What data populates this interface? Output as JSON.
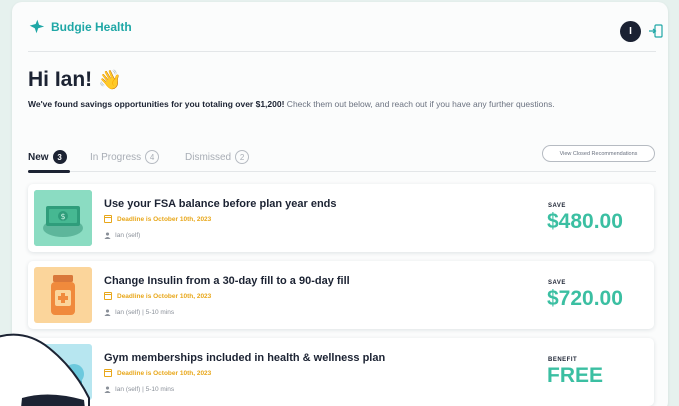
{
  "header": {
    "brand": "Budgie Health",
    "avatar_initial": "I",
    "brand_color": "#1fa7a6"
  },
  "greeting": {
    "title": "Hi Ian!",
    "emoji": "👋",
    "subtitle_bold": "We've found savings opportunities for you totaling over $1,200!",
    "subtitle_rest": " Check them out below, and reach out if you have any further questions."
  },
  "tabs": [
    {
      "label": "New",
      "count": "3"
    },
    {
      "label": "In Progress",
      "count": "4"
    },
    {
      "label": "Dismissed",
      "count": "2"
    }
  ],
  "closed_button": "View Closed Recommendations",
  "cards": [
    {
      "title": "Use your FSA balance before plan year ends",
      "deadline": "Deadline is October 10th, 2023",
      "person": "Ian (self)",
      "value_label": "SAVE",
      "value": "$480.00",
      "icon": "money-icon"
    },
    {
      "title": "Change Insulin from a 30-day fill to a 90-day fill",
      "deadline": "Deadline is October 10th, 2023",
      "person": "Ian (self) | 5-10 mins",
      "value_label": "SAVE",
      "value": "$720.00",
      "icon": "pill-bottle-icon"
    },
    {
      "title": "Gym memberships included in health & wellness plan",
      "deadline": "Deadline is October 10th, 2023",
      "person": "Ian (self) | 5-10 mins",
      "value_label": "BENEFIT",
      "value": "FREE",
      "icon": "gym-icon"
    }
  ],
  "colors": {
    "accent": "#3bbfa2",
    "deadline": "#e8a71a",
    "text_dark": "#1c2333"
  }
}
